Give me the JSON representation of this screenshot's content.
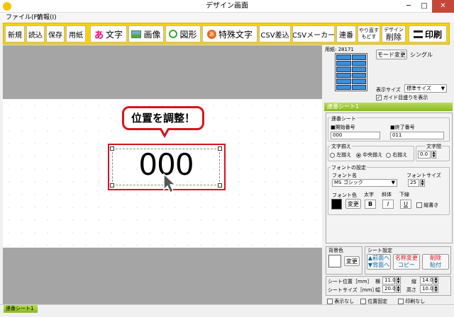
{
  "window": {
    "title": "デザイン画面",
    "minimize": "─",
    "maximize": "□",
    "close": "✕"
  },
  "menu": {
    "file": "ファイル(F)",
    "info": "情報(I)"
  },
  "toolbar": {
    "new": "新規",
    "open": "読込",
    "save": "保存",
    "paper": "用紙",
    "text_icon": "あ",
    "text": "文字",
    "image": "画像",
    "shape": "図形",
    "special_icon": "あ",
    "special_text": "特殊文字",
    "csv_insert": "CSV差込",
    "csv_maker": "CSVメーカー",
    "serial": "連番",
    "undo": "やり直す",
    "redo": "もどす",
    "design_delete_top": "デザイン",
    "design_delete": "削除",
    "print": "印刷"
  },
  "canvas": {
    "callout": "位置を調整！",
    "sample_number": "000"
  },
  "side": {
    "paper_count": "用紙: 28171",
    "mode_button": "モード変更",
    "mode_label": "シングル",
    "display_size_label": "表示サイズ",
    "display_size_value": "標準サイズ",
    "guide_label": "ガイド目盛りを表示",
    "guide_checked": true
  },
  "sheet": {
    "header": "連番シート1",
    "group_title": "連番シート",
    "start_label": "■開始番号",
    "start_value": "000",
    "end_label": "■終了番号",
    "end_value": "011",
    "align_title": "文字揃え",
    "align_left": "左揃え",
    "align_center": "中央揃え",
    "align_right": "右揃え",
    "align_selected": "center",
    "spacing_title": "文字間",
    "spacing_value": "0.0",
    "font_group_title": "フォントの設定",
    "font_name_label": "フォント名",
    "font_name_value": "MS ゴシック",
    "font_size_label": "フォントサイズ",
    "font_size_value": "25",
    "font_color_label": "フォント色",
    "change_label": "変更",
    "bold_label": "太字",
    "italic_label": "斜体",
    "underline_label": "下線",
    "bold_btn": "B",
    "italic_btn": "I",
    "underline_btn": "U",
    "vertical_label": "縦書き"
  },
  "bg": {
    "title": "背景色",
    "change": "変更"
  },
  "sheet_settings": {
    "title": "シート設定",
    "front": "▲前面へ",
    "back": "▼背面へ",
    "rename": "名称変更",
    "copy": "コピー",
    "delete": "削除",
    "paste": "貼付"
  },
  "position": {
    "pos_label": "シート位置［mm］",
    "size_label": "シートサイズ［mm］",
    "x_label": "横",
    "x_value": "11.0",
    "y_label": "縦",
    "y_value": "14.0",
    "w_label": "幅",
    "w_value": "20.0",
    "h_label": "高さ",
    "h_value": "10.0"
  },
  "options": {
    "hide": "表示なし",
    "fix": "位置固定",
    "noprint": "印刷なし"
  },
  "status": {
    "tab": "連番シート1"
  }
}
